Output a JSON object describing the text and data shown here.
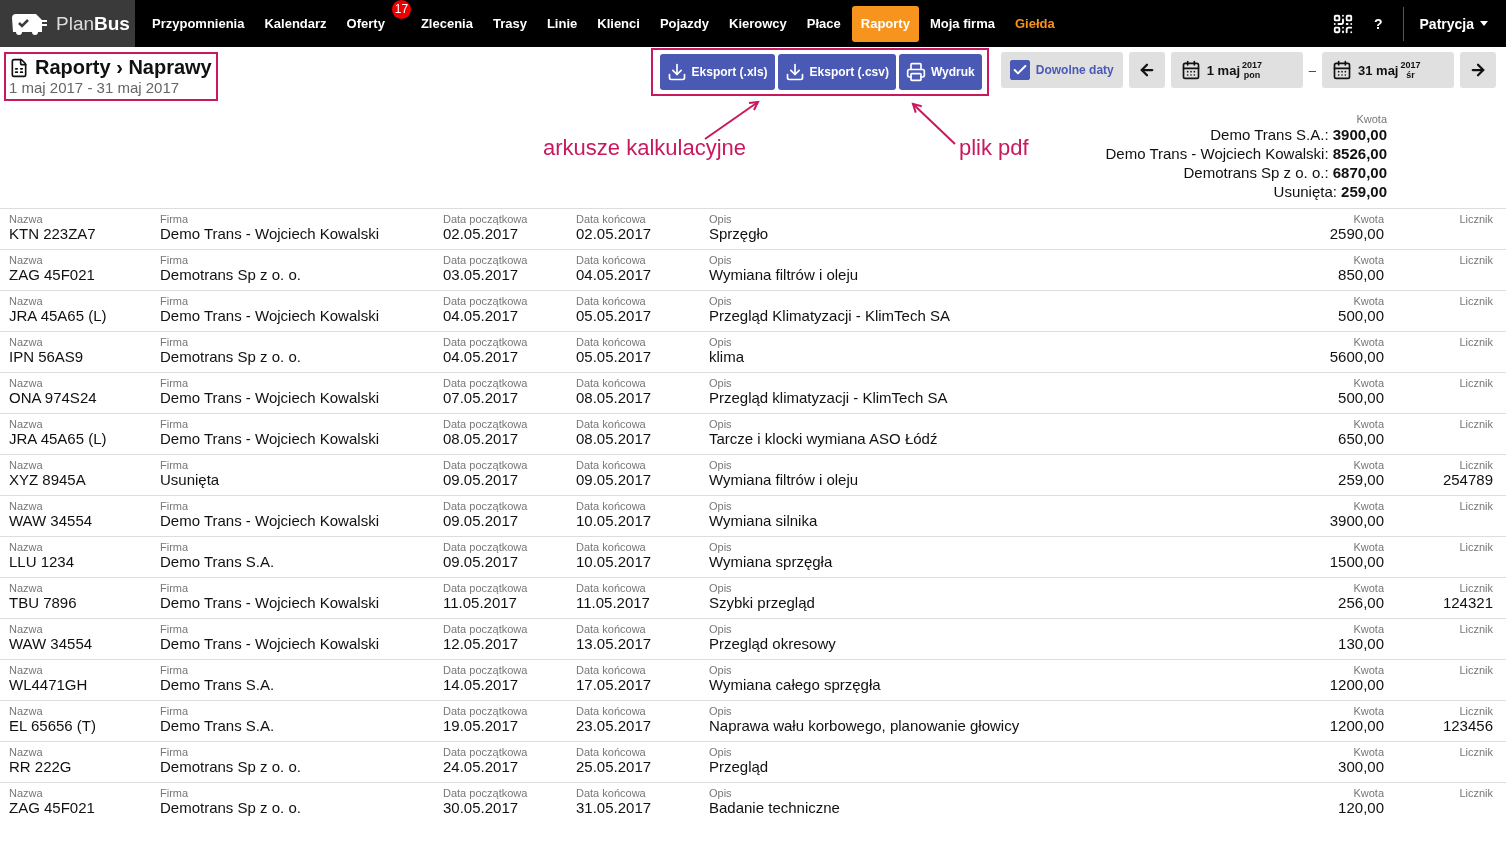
{
  "nav": {
    "logo": {
      "light": "Plan",
      "bold": "Bus"
    },
    "items": [
      {
        "label": "Przypomnienia",
        "selected": false,
        "highlight": false
      },
      {
        "label": "Kalendarz",
        "selected": false,
        "highlight": false
      },
      {
        "label": "Oferty",
        "selected": false,
        "highlight": false,
        "badge": "17"
      },
      {
        "label": "Zlecenia",
        "selected": false,
        "highlight": false
      },
      {
        "label": "Trasy",
        "selected": false,
        "highlight": false
      },
      {
        "label": "Linie",
        "selected": false,
        "highlight": false
      },
      {
        "label": "Klienci",
        "selected": false,
        "highlight": false
      },
      {
        "label": "Pojazdy",
        "selected": false,
        "highlight": false
      },
      {
        "label": "Kierowcy",
        "selected": false,
        "highlight": false
      },
      {
        "label": "Płace",
        "selected": false,
        "highlight": false
      },
      {
        "label": "Raporty",
        "selected": true,
        "highlight": false
      },
      {
        "label": "Moja firma",
        "selected": false,
        "highlight": false
      },
      {
        "label": "Giełda",
        "selected": false,
        "highlight": true
      }
    ],
    "help": "?",
    "user": "Patrycja"
  },
  "page": {
    "title": "Raporty",
    "subtitle": "Naprawy",
    "separator": "›",
    "range": "1 maj 2017 - 31 maj 2017"
  },
  "actions": [
    "Eksport (.xls)",
    "Eksport (.csv)",
    "Wydruk"
  ],
  "date_filter": {
    "any_dates": {
      "label": "Dowolne daty",
      "checked": true
    },
    "from": {
      "day": "1 maj",
      "year": "2017",
      "weekday": "pon"
    },
    "dash": "–",
    "to": {
      "day": "31 maj",
      "year": "2017",
      "weekday": "śr"
    }
  },
  "annotations": [
    "arkusze kalkulacyjne",
    "plik pdf"
  ],
  "totals": {
    "label": "Kwota",
    "items": [
      {
        "name": "Demo Trans S.A.:",
        "amount": "3900,00"
      },
      {
        "name": "Demo Trans - Wojciech Kowalski:",
        "amount": "8526,00"
      },
      {
        "name": "Demotrans Sp z o. o.:",
        "amount": "6870,00"
      },
      {
        "name": "Usunięta:",
        "amount": "259,00"
      }
    ]
  },
  "table": {
    "rows": [
      [
        [
          "Nazwa",
          "KTN 223ZA7"
        ],
        [
          "Firma",
          "Demo Trans - Wojciech Kowalski"
        ],
        [
          "Data początkowa",
          "02.05.2017"
        ],
        [
          "Data końcowa",
          "02.05.2017"
        ],
        [
          "Opis",
          "Sprzęgło"
        ],
        [
          "Kwota",
          "2590,00"
        ],
        [
          "Licznik"
        ]
      ],
      [
        [
          "Nazwa",
          "ZAG 45F021"
        ],
        [
          "Firma",
          "Demotrans Sp z o. o."
        ],
        [
          "Data początkowa",
          "03.05.2017"
        ],
        [
          "Data końcowa",
          "04.05.2017"
        ],
        [
          "Opis",
          "Wymiana filtrów i oleju"
        ],
        [
          "Kwota",
          "850,00"
        ],
        [
          "Licznik"
        ]
      ],
      [
        [
          "Nazwa",
          "JRA 45A65 (L)"
        ],
        [
          "Firma",
          "Demo Trans - Wojciech Kowalski"
        ],
        [
          "Data początkowa",
          "04.05.2017"
        ],
        [
          "Data końcowa",
          "05.05.2017"
        ],
        [
          "Opis",
          "Przegląd Klimatyzacji - KlimTech SA"
        ],
        [
          "Kwota",
          "500,00"
        ],
        [
          "Licznik"
        ]
      ],
      [
        [
          "Nazwa",
          "IPN 56AS9"
        ],
        [
          "Firma",
          "Demotrans Sp z o. o."
        ],
        [
          "Data początkowa",
          "04.05.2017"
        ],
        [
          "Data końcowa",
          "05.05.2017"
        ],
        [
          "Opis",
          "klima"
        ],
        [
          "Kwota",
          "5600,00"
        ],
        [
          "Licznik"
        ]
      ],
      [
        [
          "Nazwa",
          "ONA 974S24"
        ],
        [
          "Firma",
          "Demo Trans - Wojciech Kowalski"
        ],
        [
          "Data początkowa",
          "07.05.2017"
        ],
        [
          "Data końcowa",
          "08.05.2017"
        ],
        [
          "Opis",
          "Przegląd klimatyzacji - KlimTech SA"
        ],
        [
          "Kwota",
          "500,00"
        ],
        [
          "Licznik"
        ]
      ],
      [
        [
          "Nazwa",
          "JRA 45A65 (L)"
        ],
        [
          "Firma",
          "Demo Trans - Wojciech Kowalski"
        ],
        [
          "Data początkowa",
          "08.05.2017"
        ],
        [
          "Data końcowa",
          "08.05.2017"
        ],
        [
          "Opis",
          "Tarcze i klocki wymiana ASO Łódź"
        ],
        [
          "Kwota",
          "650,00"
        ],
        [
          "Licznik"
        ]
      ],
      [
        [
          "Nazwa",
          "XYZ 8945A"
        ],
        [
          "Firma",
          "Usunięta"
        ],
        [
          "Data początkowa",
          "09.05.2017"
        ],
        [
          "Data końcowa",
          "09.05.2017"
        ],
        [
          "Opis",
          "Wymiana filtrów i oleju"
        ],
        [
          "Kwota",
          "259,00"
        ],
        [
          "Licznik",
          "254789"
        ]
      ],
      [
        [
          "Nazwa",
          "WAW 34554"
        ],
        [
          "Firma",
          "Demo Trans - Wojciech Kowalski"
        ],
        [
          "Data początkowa",
          "09.05.2017"
        ],
        [
          "Data końcowa",
          "10.05.2017"
        ],
        [
          "Opis",
          "Wymiana silnika"
        ],
        [
          "Kwota",
          "3900,00"
        ],
        [
          "Licznik"
        ]
      ],
      [
        [
          "Nazwa",
          "LLU 1234"
        ],
        [
          "Firma",
          "Demo Trans S.A."
        ],
        [
          "Data początkowa",
          "09.05.2017"
        ],
        [
          "Data końcowa",
          "10.05.2017"
        ],
        [
          "Opis",
          "Wymiana sprzęgła"
        ],
        [
          "Kwota",
          "1500,00"
        ],
        [
          "Licznik"
        ]
      ],
      [
        [
          "Nazwa",
          "TBU 7896"
        ],
        [
          "Firma",
          "Demo Trans - Wojciech Kowalski"
        ],
        [
          "Data początkowa",
          "11.05.2017"
        ],
        [
          "Data końcowa",
          "11.05.2017"
        ],
        [
          "Opis",
          "Szybki przegląd"
        ],
        [
          "Kwota",
          "256,00"
        ],
        [
          "Licznik",
          "124321"
        ]
      ],
      [
        [
          "Nazwa",
          "WAW 34554"
        ],
        [
          "Firma",
          "Demo Trans - Wojciech Kowalski"
        ],
        [
          "Data początkowa",
          "12.05.2017"
        ],
        [
          "Data końcowa",
          "13.05.2017"
        ],
        [
          "Opis",
          "Przegląd okresowy"
        ],
        [
          "Kwota",
          "130,00"
        ],
        [
          "Licznik"
        ]
      ],
      [
        [
          "Nazwa",
          "WL4471GH"
        ],
        [
          "Firma",
          "Demo Trans S.A."
        ],
        [
          "Data początkowa",
          "14.05.2017"
        ],
        [
          "Data końcowa",
          "17.05.2017"
        ],
        [
          "Opis",
          "Wymiana całego sprzęgła"
        ],
        [
          "Kwota",
          "1200,00"
        ],
        [
          "Licznik"
        ]
      ],
      [
        [
          "Nazwa",
          "EL 65656 (T)"
        ],
        [
          "Firma",
          "Demo Trans S.A."
        ],
        [
          "Data początkowa",
          "19.05.2017"
        ],
        [
          "Data końcowa",
          "23.05.2017"
        ],
        [
          "Opis",
          "Naprawa wału korbowego, planowanie głowicy"
        ],
        [
          "Kwota",
          "1200,00"
        ],
        [
          "Licznik",
          "123456"
        ]
      ],
      [
        [
          "Nazwa",
          "RR 222G"
        ],
        [
          "Firma",
          "Demotrans Sp z o. o."
        ],
        [
          "Data początkowa",
          "24.05.2017"
        ],
        [
          "Data końcowa",
          "25.05.2017"
        ],
        [
          "Opis",
          "Przegląd"
        ],
        [
          "Kwota",
          "300,00"
        ],
        [
          "Licznik"
        ]
      ],
      [
        [
          "Nazwa",
          "ZAG 45F021"
        ],
        [
          "Firma",
          "Demotrans Sp z o. o."
        ],
        [
          "Data początkowa",
          "30.05.2017"
        ],
        [
          "Data końcowa",
          "31.05.2017"
        ],
        [
          "Opis",
          "Badanie techniczne"
        ],
        [
          "Kwota",
          "120,00"
        ],
        [
          "Licznik"
        ]
      ]
    ]
  }
}
